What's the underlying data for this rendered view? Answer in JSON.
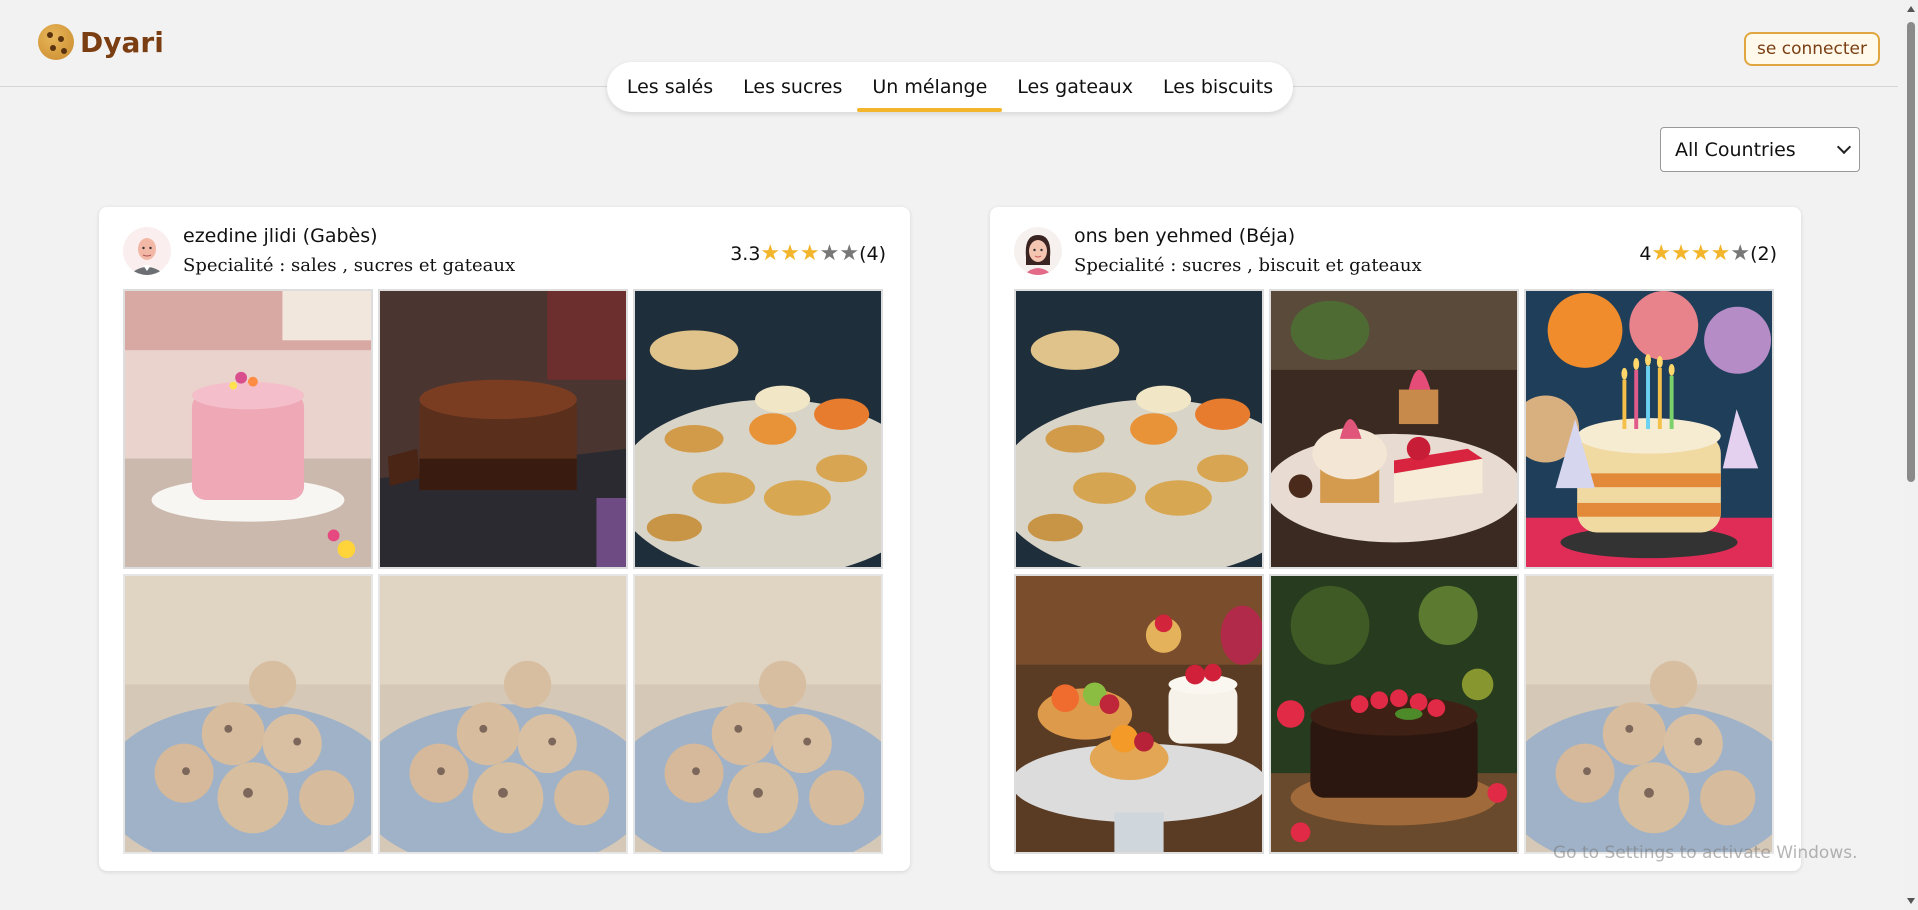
{
  "app": {
    "name": "Dyari",
    "login_label": "se connecter"
  },
  "tabs": [
    {
      "label": "Les salés"
    },
    {
      "label": "Les sucres"
    },
    {
      "label": "Un mélange",
      "active": true
    },
    {
      "label": "Les gateaux"
    },
    {
      "label": "Les biscuits"
    }
  ],
  "filter": {
    "selected": "All Countries"
  },
  "cards": [
    {
      "name": "ezedine jlidi (Gabès)",
      "specialite": "Specialité : sales , sucres et gateaux",
      "rating": "3.3",
      "stars_filled": 3,
      "review_count": "(4)",
      "photos": [
        "pink-layer-cake",
        "chocolate-mousse-cake",
        "savory-pastries-platter",
        "chocolate-chip-cookies",
        "chocolate-chip-cookies",
        "chocolate-chip-cookies"
      ]
    },
    {
      "name": "ons ben yehmed (Béja)",
      "specialite": "Specialité : sucres , biscuit et gateaux",
      "rating": "4",
      "stars_filled": 4,
      "review_count": "(2)",
      "photos": [
        "savory-pastries-platter",
        "cupcake-cheesecake-plate",
        "birthday-cake-candles",
        "fruit-tartlets",
        "chocolate-raspberry-cake",
        "chocolate-chip-cookies"
      ]
    }
  ],
  "watermark": "Go to Settings to activate Windows.",
  "colors": {
    "accent": "#f2b52b",
    "brand": "#7a3e12",
    "background": "#f2f2f2"
  }
}
